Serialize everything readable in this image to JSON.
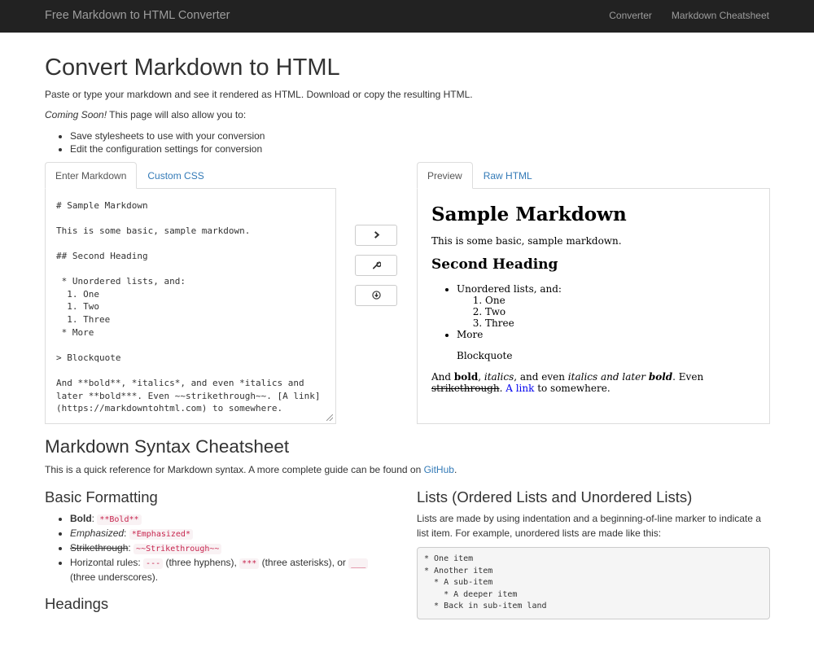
{
  "nav": {
    "brand": "Free Markdown to HTML Converter",
    "links": [
      "Converter",
      "Markdown Cheatsheet"
    ]
  },
  "intro": {
    "title": "Convert Markdown to HTML",
    "description": "Paste or type your markdown and see it rendered as HTML. Download or copy the resulting HTML.",
    "coming_soon_em": "Coming Soon!",
    "coming_soon_rest": " This page will also allow you to:",
    "features": [
      "Save stylesheets to use with your conversion",
      "Edit the configuration settings for conversion"
    ]
  },
  "editor": {
    "tabs": [
      "Enter Markdown",
      "Custom CSS"
    ],
    "content": "# Sample Markdown\n\nThis is some basic, sample markdown.\n\n## Second Heading\n\n * Unordered lists, and:\n  1. One\n  1. Two\n  1. Three\n * More\n\n> Blockquote\n\nAnd **bold**, *italics*, and even *italics and\nlater **bold***. Even ~~strikethrough~~. [A link]\n(https://markdowntohtml.com) to somewhere."
  },
  "actions": {
    "icons": [
      "chevron-right-icon",
      "wrench-icon",
      "download-icon"
    ]
  },
  "preview": {
    "tabs": [
      "Preview",
      "Raw HTML"
    ],
    "h1": "Sample Markdown",
    "p1": "This is some basic, sample markdown.",
    "h2": "Second Heading",
    "ul_item1": "Unordered lists, and:",
    "ol_items": [
      "One",
      "Two",
      "Three"
    ],
    "ul_item2": "More",
    "blockquote": "Blockquote",
    "p2": {
      "and": "And ",
      "bold": "bold",
      "comma1": ", ",
      "italics": "italics",
      "and_even": ", and even ",
      "italics_later": "italics and later ",
      "bold_italic": "bold",
      "even": ". Even ",
      "strike": "strikethrough",
      "dot": ". ",
      "link": "A link",
      "to_somewhere": " to somewhere."
    }
  },
  "cheatsheet": {
    "title": "Markdown Syntax Cheatsheet",
    "desc": "This is a quick reference for Markdown syntax. A more complete guide can be found on ",
    "desc_link": "GitHub",
    "desc_end": ".",
    "basic": {
      "title": "Basic Formatting",
      "bold_label": "Bold",
      "bold_code": "**Bold**",
      "emph_label": "Emphasized",
      "emph_code": "*Emphasized*",
      "strike_label": "Strikethrough",
      "strike_code": "~~Strikethrough~~",
      "hr_label": "Horizontal rules: ",
      "hr_code1": "---",
      "hr_text1": " (three hyphens), ",
      "hr_code2": "***",
      "hr_text2": " (three asterisks), or ",
      "hr_code3": "___",
      "hr_text3": " (three underscores)."
    },
    "headings_title": "Headings",
    "lists": {
      "title": "Lists (Ordered Lists and Unordered Lists)",
      "desc": "Lists are made by using indentation and a beginning-of-line marker to indicate a list item. For example, unordered lists are made like this:",
      "code": "* One item\n* Another item\n  * A sub-item\n    * A deeper item\n  * Back in sub-item land"
    }
  }
}
